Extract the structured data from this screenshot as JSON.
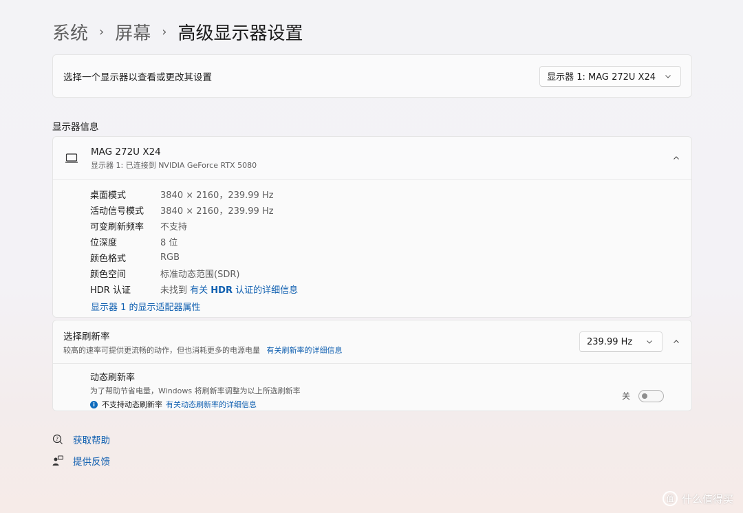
{
  "breadcrumb": {
    "items": [
      "系统",
      "屏幕"
    ],
    "current": "高级显示器设置"
  },
  "monitor_select": {
    "label": "选择一个显示器以查看或更改其设置",
    "value": "显示器 1: MAG 272U X24"
  },
  "display_info": {
    "section_title": "显示器信息",
    "name": "MAG 272U X24",
    "subtitle": "显示器 1: 已连接到 NVIDIA GeForce RTX 5080",
    "rows": [
      {
        "key": "桌面模式",
        "value": "3840 × 2160，239.99 Hz"
      },
      {
        "key": "活动信号模式",
        "value": "3840 × 2160，239.99 Hz"
      },
      {
        "key": "可变刷新频率",
        "value": "不支持"
      },
      {
        "key": "位深度",
        "value": "8 位"
      },
      {
        "key": "颜色格式",
        "value": "RGB"
      },
      {
        "key": "颜色空间",
        "value": "标准动态范围(SDR)"
      },
      {
        "key": "HDR 认证",
        "value": "未找到 "
      }
    ],
    "hdr_link_pre": "有关 ",
    "hdr_link_bold": "HDR",
    "hdr_link_post": " 认证的详细信息",
    "adapter_link": "显示器 1 的显示适配器属性"
  },
  "refresh_rate": {
    "title": "选择刷新率",
    "description": "较高的速率可提供更流畅的动作，但也消耗更多的电源电量",
    "link": "有关刷新率的详细信息",
    "value": "239.99 Hz",
    "dynamic": {
      "title": "动态刷新率",
      "description": "为了帮助节省电量，Windows 将刷新率调整为以上所选刷新率",
      "note": "不支持动态刷新率",
      "note_link": "有关动态刷新率的详细信息",
      "toggle_label": "关",
      "toggle_on": false
    }
  },
  "help": {
    "get_help": "获取帮助",
    "feedback": "提供反馈"
  },
  "watermark": {
    "text": "什么值得买",
    "logo": "值"
  },
  "icons": [
    "chevron-right-icon",
    "chevron-down-icon",
    "chevron-up-icon",
    "monitor-icon",
    "help-icon",
    "feedback-icon",
    "info-icon"
  ],
  "colors": {
    "link": "#0f5fb0",
    "info_badge": "#0f6cbd"
  }
}
